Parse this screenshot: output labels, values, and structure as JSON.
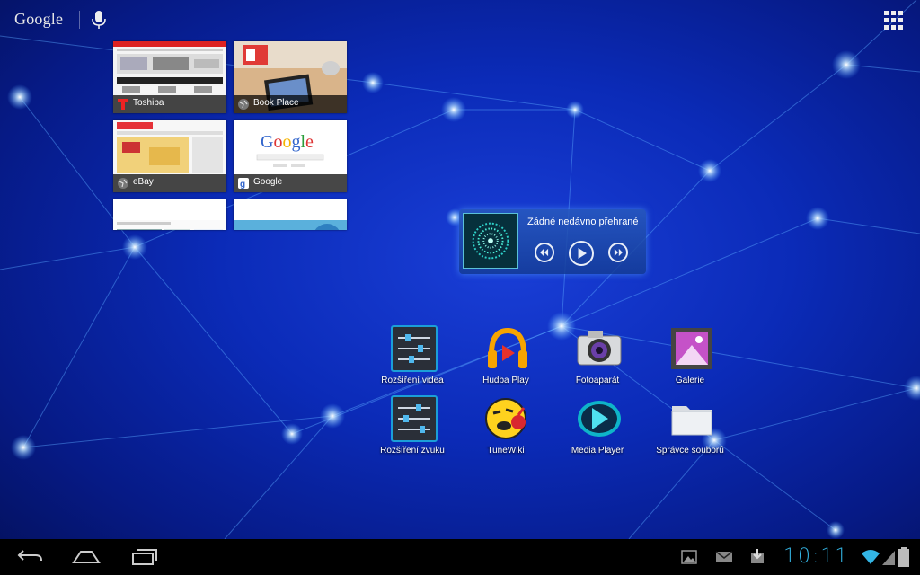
{
  "topbar": {
    "search_logo": "Google",
    "mic_icon": "mic-icon",
    "apps_icon": "all-apps-icon"
  },
  "bookmarks": [
    {
      "label": "Toshiba",
      "icon": "toshiba-icon"
    },
    {
      "label": "Book Place",
      "icon": "web-icon"
    },
    {
      "label": "eBay",
      "icon": "web-icon"
    },
    {
      "label": "Google",
      "icon": "google-icon"
    }
  ],
  "music_widget": {
    "title": "Žádné nedávno přehrané",
    "prev_icon": "prev-icon",
    "play_icon": "play-icon",
    "next_icon": "next-icon"
  },
  "apps": [
    {
      "label": "Rozšíření videa",
      "icon": "equalizer-icon"
    },
    {
      "label": "Hudba Play",
      "icon": "headphones-icon"
    },
    {
      "label": "Fotoaparát",
      "icon": "camera-icon"
    },
    {
      "label": "Galerie",
      "icon": "gallery-icon"
    },
    {
      "label": "Rozšíření zvuku",
      "icon": "equalizer-icon"
    },
    {
      "label": "TuneWiki",
      "icon": "tunewiki-icon"
    },
    {
      "label": "Media Player",
      "icon": "media-player-icon"
    },
    {
      "label": "Správce souborů",
      "icon": "folder-icon"
    }
  ],
  "statusbar": {
    "time": "10:11"
  },
  "colors": {
    "accent": "#33b5e5",
    "wallpaper": "#0b2bb8"
  }
}
